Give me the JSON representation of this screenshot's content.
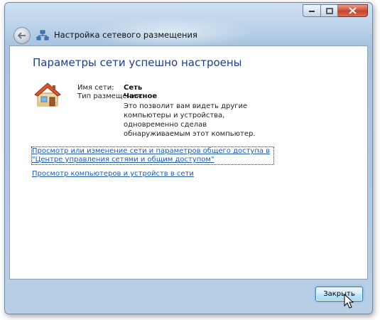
{
  "window": {
    "title": "Настройка сетевого размещения",
    "controls": [
      "minimize-icon",
      "maximize-icon",
      "close-icon"
    ]
  },
  "content": {
    "heading": "Параметры сети успешно настроены",
    "network_name_label": "Имя сети:",
    "network_name_value": "Сеть",
    "location_type_label": "Тип размещения:",
    "location_type_value": "Частное",
    "description": "Это позволит вам видеть другие компьютеры и устройства, одновременно сделав обнаруживаемым этот компьютер.",
    "link_sharing_center": "Просмотр или изменение сети и параметров общего доступа в \"Центре управления сетями и общим доступом\"",
    "link_view_computers": "Просмотр компьютеров и устройств в сети"
  },
  "footer": {
    "close_button": "Закрыть"
  },
  "colors": {
    "heading": "#1e3e8a",
    "link": "#1d5bb5",
    "frame": "#a9c4df"
  }
}
